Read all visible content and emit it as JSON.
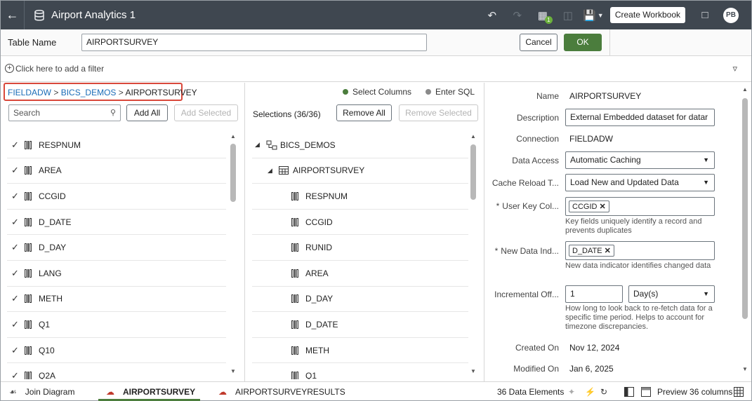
{
  "header": {
    "title": "Airport Analytics 1",
    "create_workbook": "Create Workbook",
    "avatar": "PB",
    "badge": "1"
  },
  "table_name": {
    "label": "Table Name",
    "value": "AIRPORTSURVEY",
    "cancel": "Cancel",
    "ok": "OK"
  },
  "filter": {
    "placeholder": "Click here to add a filter"
  },
  "breadcrumb": {
    "items": [
      "FIELDADW",
      "BICS_DEMOS",
      "AIRPORTSURVEY"
    ],
    "separator": ">"
  },
  "mode": {
    "select_columns": "Select Columns",
    "enter_sql": "Enter SQL"
  },
  "left": {
    "search_placeholder": "Search",
    "add_all": "Add All",
    "add_selected": "Add Selected",
    "columns": [
      "RESPNUM",
      "AREA",
      "CCGID",
      "D_DATE",
      "D_DAY",
      "LANG",
      "METH",
      "Q1",
      "Q10",
      "Q2A"
    ]
  },
  "middle": {
    "selections_label": "Selections (36/36)",
    "remove_all": "Remove All",
    "remove_selected": "Remove Selected",
    "schema": "BICS_DEMOS",
    "table": "AIRPORTSURVEY",
    "columns": [
      "RESPNUM",
      "CCGID",
      "RUNID",
      "AREA",
      "D_DAY",
      "D_DATE",
      "METH",
      "Q1"
    ]
  },
  "props": {
    "name_label": "Name",
    "name_value": "AIRPORTSURVEY",
    "desc_label": "Description",
    "desc_value": "External Embedded dataset for datar",
    "conn_label": "Connection",
    "conn_value": "FIELDADW",
    "access_label": "Data Access",
    "access_value": "Automatic Caching",
    "reload_label": "Cache Reload T...",
    "reload_value": "Load New and Updated Data",
    "userkey_label": "User Key Col...",
    "userkey_chip": "CCGID",
    "userkey_help": "Key fields uniquely identify a record and prevents duplicates",
    "newdata_label": "New Data Ind...",
    "newdata_chip": "D_DATE",
    "newdata_help": "New data indicator identifies changed data",
    "incr_label": "Incremental Off...",
    "incr_value": "1",
    "incr_unit": "Day(s)",
    "incr_help": "How long to look back to re-fetch data for a specific time period. Helps to account for timezone discrepancies.",
    "created_label": "Created On",
    "created_value": "Nov 12, 2024",
    "modified_label": "Modified On",
    "modified_value": "Jan 6, 2025"
  },
  "footer": {
    "join_diagram": "Join Diagram",
    "tab1": "AIRPORTSURVEY",
    "tab2": "AIRPORTSURVEYRESULTS",
    "elements": "36 Data Elements",
    "preview": "Preview 36 columns"
  },
  "colors": {
    "header_bg": "#3f4750",
    "ok_green": "#4b7d3d",
    "link_blue": "#1a6cb7",
    "highlight_red": "#d9483b"
  }
}
